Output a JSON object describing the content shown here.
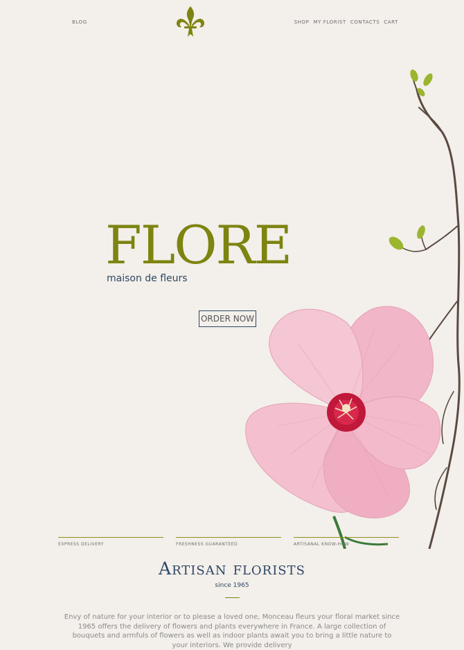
{
  "nav": {
    "left_link": "BLOG",
    "right_links": [
      "SHOP",
      "MY FLORIST",
      "CONTACTS",
      "CART"
    ],
    "logo_icon": "fleur-de-lis-icon"
  },
  "hero": {
    "title": "FLORE",
    "subtitle": "maison de fleurs",
    "cta_label": "ORDER NOW"
  },
  "features": [
    "EXPRESS DELIVERY",
    "FRESHNESS GUARANTEED",
    "ARTISANAL KNOW-HOW"
  ],
  "about": {
    "title": "Artisan florists",
    "since": "since 1965",
    "text": "Envy of nature for your interior or to please a loved one, Monceau fleurs your floral market since 1965 offers the delivery of flowers and plants everywhere in France. A large collection of bouquets and armfuls of flowers as well as indoor plants await you to bring a little nature to your interiors. We provide delivery"
  },
  "colors": {
    "background": "#f3efea",
    "accent_green": "#7d8410",
    "navy": "#2d4766",
    "flower_pink": "#f2b6c9"
  }
}
